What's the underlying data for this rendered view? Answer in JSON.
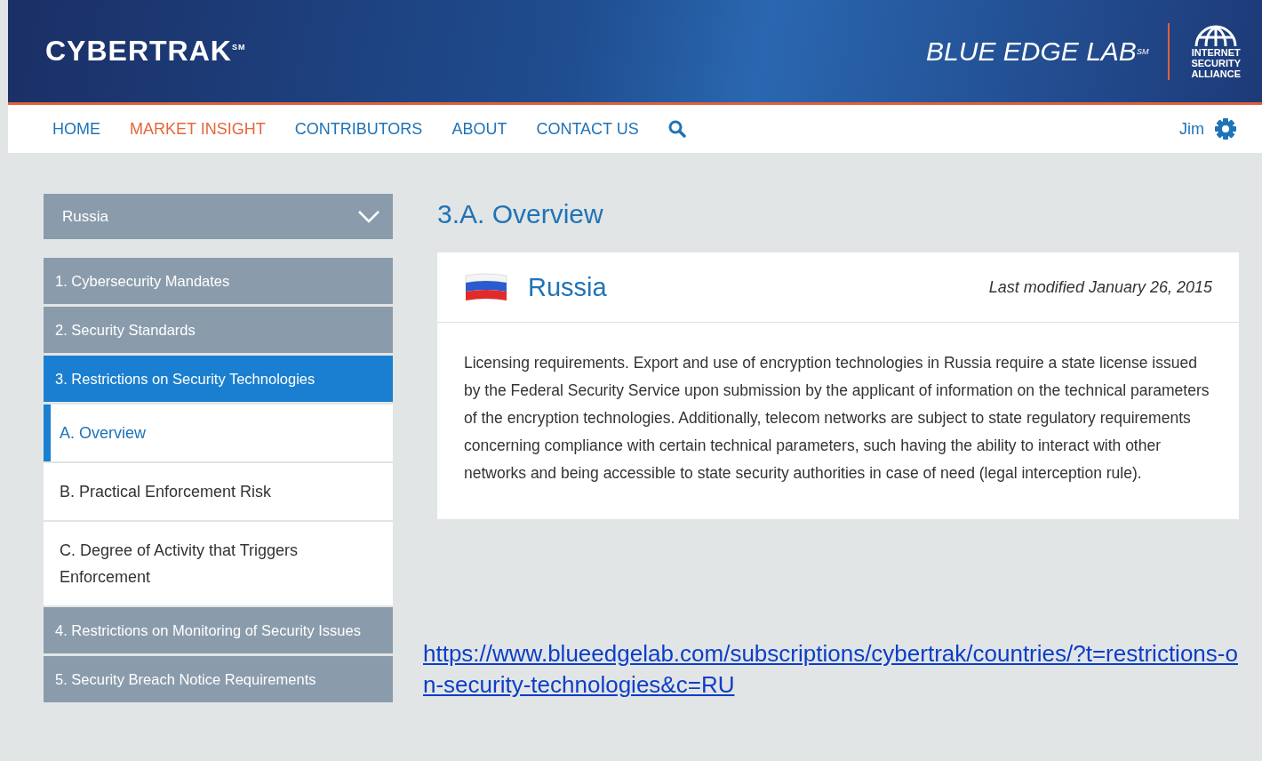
{
  "header": {
    "brand": "CYBERTRAK$^{SM}$",
    "lab": "BLUE EDGE LAB$^{SM}$",
    "alliance": [
      "INTERNET",
      "SECURITY",
      "ALLIANCE"
    ]
  },
  "nav": {
    "items": [
      {
        "label": "HOME",
        "selected": false
      },
      {
        "label": "MARKET INSIGHT",
        "selected": true
      },
      {
        "label": "CONTRIBUTORS",
        "selected": false
      },
      {
        "label": "ABOUT",
        "selected": false
      },
      {
        "label": "CONTACT US",
        "selected": false
      }
    ],
    "user": "Jim"
  },
  "sidebar": {
    "country": "Russia",
    "items": [
      {
        "kind": "section",
        "label": "1. Cybersecurity Mandates",
        "selected": false
      },
      {
        "kind": "section",
        "label": "2. Security Standards",
        "selected": false
      },
      {
        "kind": "section",
        "label": "3. Restrictions on Security Technologies",
        "selected": true
      },
      {
        "kind": "subsection",
        "label": "A. Overview",
        "selected": true
      },
      {
        "kind": "subsection",
        "label": "B. Practical Enforcement Risk",
        "selected": false
      },
      {
        "kind": "subsection",
        "label": "C. Degree of Activity that Triggers Enforcement",
        "selected": false
      },
      {
        "kind": "section",
        "label": "4. Restrictions on Monitoring of Security Issues",
        "selected": false
      },
      {
        "kind": "section",
        "label": "5. Security Breach Notice Requirements",
        "selected": false
      }
    ]
  },
  "content": {
    "heading": "3.A. Overview",
    "card": {
      "country": "Russia",
      "modified": "Last modified January 26, 2015",
      "body": "Licensing requirements. Export and use of encryption technologies in Russia require a state license issued by the Federal Security Service upon submission by the applicant of information on the technical parameters of the encryption technologies. Additionally, telecom networks are subject to state regulatory requirements concerning compliance with certain technical parameters, such having the ability to interact with other networks and being accessible to state security authorities in case of need (legal interception rule)."
    },
    "url": "https://www.blueedgelab.com/subscriptions/cybertrak/countries/?t=restrictions-on-security-technologies&c=RU"
  }
}
